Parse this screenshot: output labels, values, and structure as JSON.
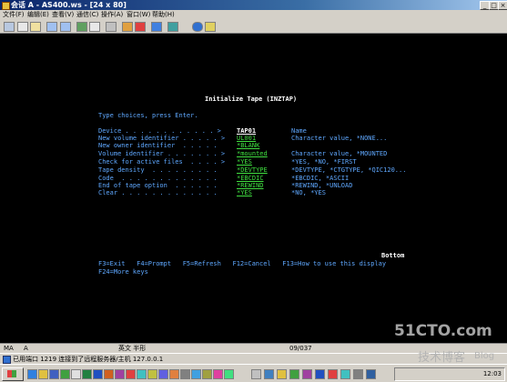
{
  "window": {
    "title": "会话 A - AS400.ws - [24 x 80]"
  },
  "menu": {
    "items": [
      "文件(F)",
      "编辑(E)",
      "查看(V)",
      "通信(C)",
      "操作(A)",
      "窗口(W)",
      "帮助(H)"
    ]
  },
  "screen": {
    "title": "Initialize Tape (INZTAP)",
    "instruction": "Type choices, press Enter.",
    "rows": [
      {
        "label": "Device . . . . . . . . . . . . >",
        "value": "TAP01",
        "hint": "Name"
      },
      {
        "label": "New volume identifier . . . . . >",
        "value": "UL001",
        "hint": "Character value, *NONE..."
      },
      {
        "label": "New owner identifier  . . . . .",
        "value": "*BLANK",
        "hint": ""
      },
      {
        "label": "Volume identifier . . . . . . . >",
        "value": "*mounted",
        "hint": "Character value, *MOUNTED"
      },
      {
        "label": "Check for active files  . . . . >",
        "value": "*YES",
        "hint": "*YES, *NO, *FIRST"
      },
      {
        "label": "Tape density  . . . . . . . . .",
        "value": "*DEVTYPE",
        "hint": "*DEVTYPE, *CTGTYPE, *QIC120..."
      },
      {
        "label": "Code  . . . . . . . . . . . . .",
        "value": "*EBCDIC",
        "hint": "*EBCDIC, *ASCII"
      },
      {
        "label": "End of tape option  . . . . . .",
        "value": "*REWIND",
        "hint": "*REWIND, *UNLOAD"
      },
      {
        "label": "Clear . . . . . . . . . . . . .",
        "value": "*YES",
        "hint": "*NO, *YES"
      }
    ],
    "bottom": "Bottom",
    "function_keys_1": "F3=Exit   F4=Prompt   F5=Refresh   F12=Cancel   F13=How to use this display",
    "function_keys_2": "F24=More keys"
  },
  "status": {
    "mode": "MA",
    "session": "A",
    "input": "英文 半形",
    "cursor": "09/037"
  },
  "message": "已用端口 1219 连接到了远程服务器/主机 127.0.0.1",
  "tray": {
    "time": "12:03"
  },
  "watermark": {
    "line1": "51CTO.com",
    "line2": "技术博客",
    "line3": "Blog"
  },
  "colors": {
    "terminal_bg": "#000000",
    "label": "#5fa8ff",
    "value": "#40e040",
    "title": "#ffffff"
  }
}
